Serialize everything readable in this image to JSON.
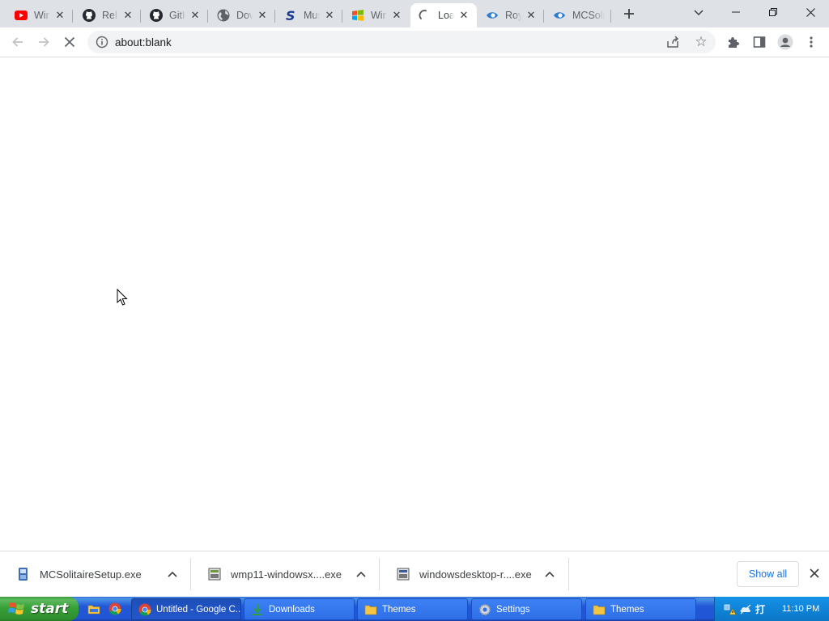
{
  "tabs": [
    {
      "title": "Windows",
      "icon": "youtube-icon"
    },
    {
      "title": "Releases",
      "icon": "github-icon"
    },
    {
      "title": "GitHub",
      "icon": "github-icon"
    },
    {
      "title": "Downloads",
      "icon": "globe-icon"
    },
    {
      "title": "MuseScore",
      "icon": "s-logo-icon"
    },
    {
      "title": "Windows",
      "icon": "windows-flag-icon"
    },
    {
      "title": "Loading",
      "icon": "loading-spinner-icon",
      "active": true
    },
    {
      "title": "Royale",
      "icon": "eye-logo-icon"
    },
    {
      "title": "MCSolitaire",
      "icon": "eye-logo-icon"
    }
  ],
  "address": {
    "url": "about:blank"
  },
  "downloads": [
    {
      "name": "MCSolitaireSetup.exe",
      "icon": "installer-file-icon"
    },
    {
      "name": "wmp11-windowsx....exe",
      "icon": "setup-file-icon"
    },
    {
      "name": "windowsdesktop-r....exe",
      "icon": "setup-file-icon"
    }
  ],
  "shelf": {
    "show_all": "Show all"
  },
  "taskbar": {
    "start_label": "start",
    "buttons": [
      {
        "label": "Untitled - Google C...",
        "icon": "chrome-icon",
        "active": true
      },
      {
        "label": "Downloads",
        "icon": "download-arrow-icon"
      },
      {
        "label": "Themes",
        "icon": "folder-icon"
      },
      {
        "label": "Settings",
        "icon": "gear-icon"
      },
      {
        "label": "Themes",
        "icon": "folder-icon"
      }
    ],
    "clock": "11:10 PM"
  },
  "colors": {
    "accent": "#1a73e8",
    "taskbar": "#2157d7",
    "start": "#37a137",
    "tray": "#0f84d9"
  }
}
